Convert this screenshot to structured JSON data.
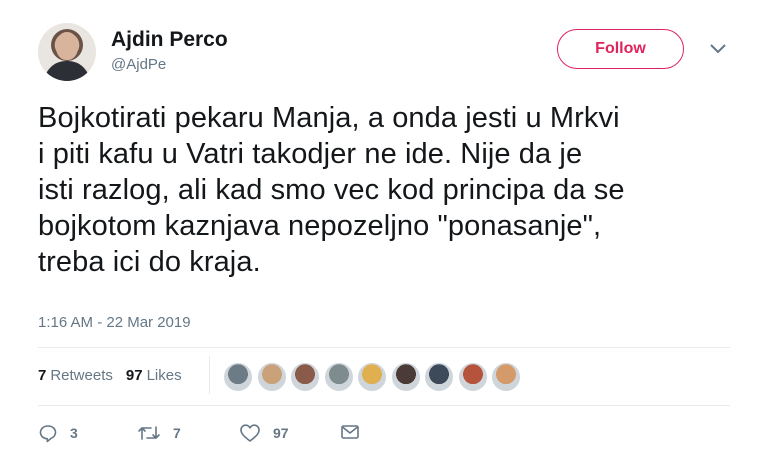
{
  "author": {
    "name": "Ajdin Perco",
    "handle": "@AjdPe"
  },
  "header": {
    "follow_label": "Follow",
    "menu_icon": "chevron-down-icon"
  },
  "tweet": {
    "text": "Bojkotirati pekaru Manja, a onda jesti u Mrkvi\ni piti kafu u Vatri takodjer ne ide. Nije da je\nisti razlog, ali kad smo vec kod principa da se\nbojkotom kaznjava nepozeljno \"ponasanje\",\ntreba ici do kraja.",
    "timestamp": "1:16 AM - 22 Mar 2019"
  },
  "stats": {
    "retweets_count": "7",
    "retweets_label": "Retweets",
    "likes_count": "97",
    "likes_label": "Likes"
  },
  "likers": [
    {
      "name": "liker-avatar-1",
      "color": "#6d7b86"
    },
    {
      "name": "liker-avatar-2",
      "color": "#c9a27a"
    },
    {
      "name": "liker-avatar-3",
      "color": "#8a5a4a"
    },
    {
      "name": "liker-avatar-4",
      "color": "#7f8c8d"
    },
    {
      "name": "liker-avatar-5",
      "color": "#e0b050"
    },
    {
      "name": "liker-avatar-6",
      "color": "#4a3b36"
    },
    {
      "name": "liker-avatar-7",
      "color": "#3c4a5a"
    },
    {
      "name": "liker-avatar-8",
      "color": "#b5533c"
    },
    {
      "name": "liker-avatar-9",
      "color": "#d49a6a"
    }
  ],
  "actions": {
    "reply_count": "3",
    "retweet_count": "7",
    "like_count": "97"
  },
  "colors": {
    "accent": "#e0245e",
    "muted": "#657786",
    "divider": "#e6ecf0"
  }
}
